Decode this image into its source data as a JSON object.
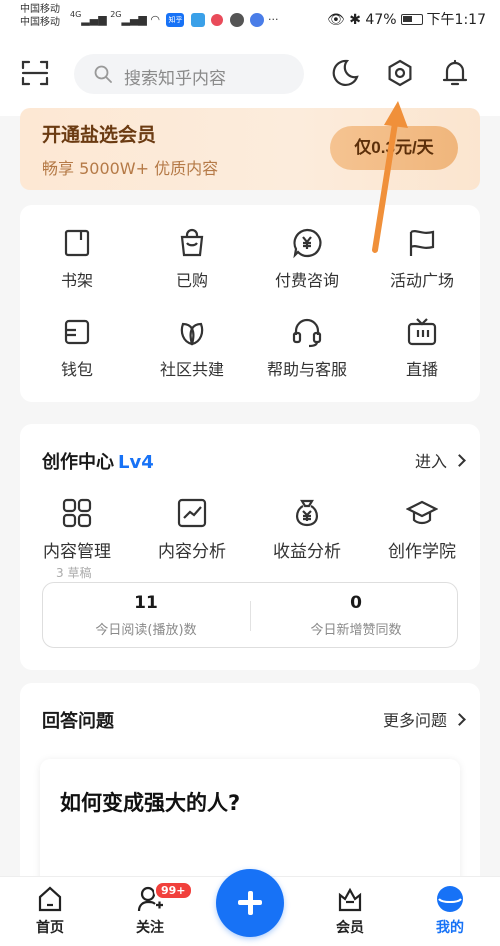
{
  "status_bar": {
    "carrier_1": "中国移动",
    "carrier_2": "中国移动",
    "network_1": "4G",
    "network_2": "2G",
    "battery": "47%",
    "time": "下午1:17",
    "app_notification_labels": [
      "知乎"
    ]
  },
  "header": {
    "search_placeholder": "搜索知乎内容",
    "icons": [
      "scan-icon",
      "moon-icon",
      "settings-icon",
      "bell-icon"
    ]
  },
  "vip_banner": {
    "title": "开通盐选会员",
    "subtitle": "畅享 5000W+ 优质内容",
    "button": "仅0.3元/天"
  },
  "shortcuts": [
    {
      "label": "书架",
      "icon": "bookshelf-icon"
    },
    {
      "label": "已购",
      "icon": "shopping-bag-icon"
    },
    {
      "label": "付费咨询",
      "icon": "paid-consult-icon"
    },
    {
      "label": "活动广场",
      "icon": "flag-icon"
    },
    {
      "label": "钱包",
      "icon": "wallet-icon"
    },
    {
      "label": "社区共建",
      "icon": "leaf-icon"
    },
    {
      "label": "帮助与客服",
      "icon": "headset-icon"
    },
    {
      "label": "直播",
      "icon": "tv-icon"
    }
  ],
  "creator_center": {
    "title": "创作中心",
    "level": "Lv4",
    "enter": "进入",
    "items": [
      {
        "label": "内容管理",
        "icon": "grid-icon"
      },
      {
        "label": "内容分析",
        "icon": "chart-icon"
      },
      {
        "label": "收益分析",
        "icon": "money-bag-icon"
      },
      {
        "label": "创作学院",
        "icon": "graduation-cap-icon"
      }
    ],
    "drafts": "3 草稿",
    "stats": [
      {
        "value": "11",
        "label": "今日阅读(播放)数"
      },
      {
        "value": "0",
        "label": "今日新增赞同数"
      }
    ]
  },
  "answer_section": {
    "title": "回答问题",
    "more": "更多问题",
    "question": "如何变成强大的人?"
  },
  "bottom_nav": {
    "items": [
      {
        "label": "首页",
        "icon": "home-icon"
      },
      {
        "label": "关注",
        "icon": "follow-icon",
        "badge": "99+"
      },
      {
        "label": "会员",
        "icon": "vip-icon"
      },
      {
        "label": "我的",
        "icon": "profile-icon",
        "active": true
      }
    ],
    "fab_icon": "plus-icon"
  },
  "colors": {
    "accent": "#1772f6",
    "vip_text": "#6b3b12",
    "badge": "#f1403c",
    "annotation_arrow": "#f0903a"
  }
}
